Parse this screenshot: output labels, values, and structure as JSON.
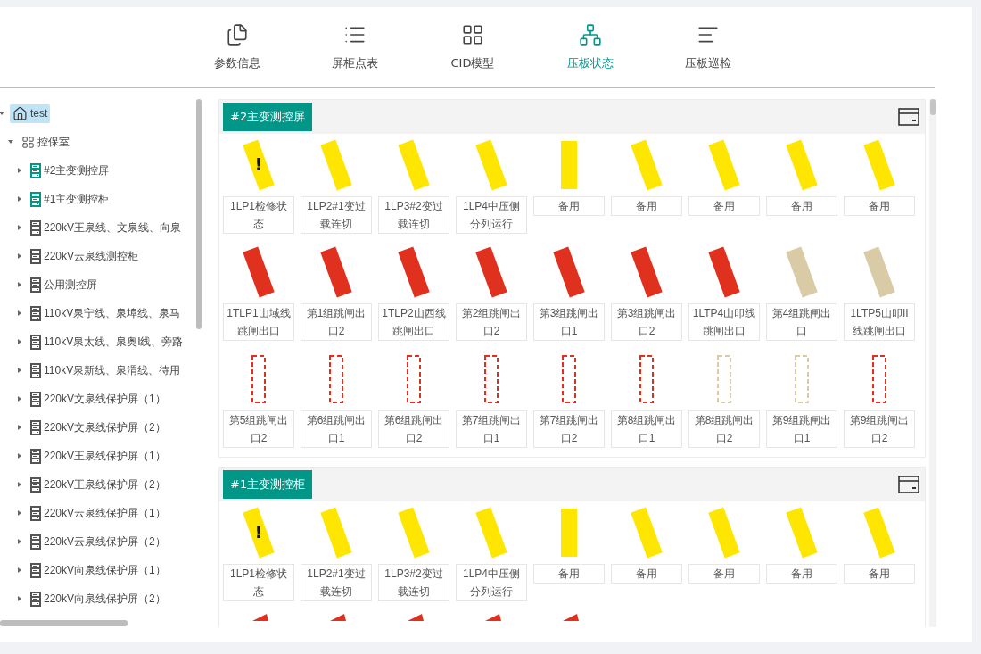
{
  "tabs": [
    {
      "label": "参数信息",
      "selected": false
    },
    {
      "label": "屏柜点表",
      "selected": false
    },
    {
      "label": "CID模型",
      "selected": false
    },
    {
      "label": "压板状态",
      "selected": true
    },
    {
      "label": "压板巡检",
      "selected": false
    }
  ],
  "tree": {
    "label": "test",
    "kind": "home",
    "expanded": true,
    "selected": true,
    "children": [
      {
        "label": "控保室",
        "kind": "room",
        "expanded": true,
        "selected": false,
        "children": [
          {
            "label": "#2主变测控屏",
            "kind": "cabinet",
            "color": "#009688",
            "expanded": false,
            "selected": false
          },
          {
            "label": "#1主变测控柜",
            "kind": "cabinet",
            "color": "#009688",
            "expanded": false,
            "selected": false
          },
          {
            "label": "220kV王泉线、文泉线、向泉",
            "kind": "cabinet",
            "color": "#555555",
            "expanded": false,
            "selected": false
          },
          {
            "label": "220kV云泉线测控柜",
            "kind": "cabinet",
            "color": "#555555",
            "expanded": false,
            "selected": false
          },
          {
            "label": "公用测控屏",
            "kind": "cabinet",
            "color": "#555555",
            "expanded": false,
            "selected": false
          },
          {
            "label": "110kV泉宁线、泉埠线、泉马",
            "kind": "cabinet",
            "color": "#555555",
            "expanded": false,
            "selected": false
          },
          {
            "label": "110kV泉太线、泉奥I线、旁路",
            "kind": "cabinet",
            "color": "#555555",
            "expanded": false,
            "selected": false
          },
          {
            "label": "110kV泉新线、泉渭线、待用",
            "kind": "cabinet",
            "color": "#555555",
            "expanded": false,
            "selected": false
          },
          {
            "label": "220kV文泉线保护屏（1）",
            "kind": "cabinet",
            "color": "#555555",
            "expanded": false,
            "selected": false
          },
          {
            "label": "220kV文泉线保护屏（2）",
            "kind": "cabinet",
            "color": "#555555",
            "expanded": false,
            "selected": false
          },
          {
            "label": "220kV王泉线保护屏（1）",
            "kind": "cabinet",
            "color": "#555555",
            "expanded": false,
            "selected": false
          },
          {
            "label": "220kV王泉线保护屏（2）",
            "kind": "cabinet",
            "color": "#555555",
            "expanded": false,
            "selected": false
          },
          {
            "label": "220kV云泉线保护屏（1）",
            "kind": "cabinet",
            "color": "#555555",
            "expanded": false,
            "selected": false
          },
          {
            "label": "220kV云泉线保护屏（2）",
            "kind": "cabinet",
            "color": "#555555",
            "expanded": false,
            "selected": false
          },
          {
            "label": "220kV向泉线保护屏（1）",
            "kind": "cabinet",
            "color": "#555555",
            "expanded": false,
            "selected": false
          },
          {
            "label": "220kV向泉线保护屏（2）",
            "kind": "cabinet",
            "color": "#555555",
            "expanded": false,
            "selected": false
          }
        ]
      }
    ]
  },
  "panels": [
    {
      "title": "#2主变测控屏",
      "plates": [
        {
          "label": "1LP1检修状态",
          "kind": "tilted",
          "color": "#ffe600",
          "badge": "!"
        },
        {
          "label": "1LP2#1变过载连切",
          "kind": "tilted",
          "color": "#ffe600"
        },
        {
          "label": "1LP3#2变过载连切",
          "kind": "tilted",
          "color": "#ffe600"
        },
        {
          "label": "1LP4中压侧分列运行",
          "kind": "tilted",
          "color": "#ffe600"
        },
        {
          "label": "备用",
          "kind": "upright",
          "color": "#ffe600"
        },
        {
          "label": "备用",
          "kind": "tilted",
          "color": "#ffe600"
        },
        {
          "label": "备用",
          "kind": "tilted",
          "color": "#ffe600"
        },
        {
          "label": "备用",
          "kind": "tilted",
          "color": "#ffe600"
        },
        {
          "label": "备用",
          "kind": "tilted",
          "color": "#ffe600"
        },
        {
          "label": "1TLP1山域线跳闸出口",
          "kind": "tilted",
          "color": "#e0301e"
        },
        {
          "label": "第1组跳闸出口2",
          "kind": "tilted",
          "color": "#e0301e"
        },
        {
          "label": "1TLP2山西线跳闸出口",
          "kind": "tilted",
          "color": "#e0301e"
        },
        {
          "label": "第2组跳闸出口2",
          "kind": "tilted",
          "color": "#e0301e"
        },
        {
          "label": "第3组跳闸出口1",
          "kind": "tilted",
          "color": "#e0301e"
        },
        {
          "label": "第3组跳闸出口2",
          "kind": "tilted",
          "color": "#e0301e"
        },
        {
          "label": "1LTP4山叩线跳闸出口",
          "kind": "tilted",
          "color": "#e0301e"
        },
        {
          "label": "第4组跳闸出口",
          "kind": "tilted",
          "color": "#d8cba6"
        },
        {
          "label": "1LTP5山叩II线跳闸出口",
          "kind": "tilted",
          "color": "#d8cba6"
        },
        {
          "label": "第5组跳闸出口2",
          "kind": "outline",
          "color": "#e0301e"
        },
        {
          "label": "第6组跳闸出口1",
          "kind": "outline",
          "color": "#e0301e"
        },
        {
          "label": "第6组跳闸出口2",
          "kind": "outline",
          "color": "#e0301e"
        },
        {
          "label": "第7组跳闸出口1",
          "kind": "outline",
          "color": "#e0301e"
        },
        {
          "label": "第7组跳闸出口2",
          "kind": "outline",
          "color": "#e0301e"
        },
        {
          "label": "第8组跳闸出口1",
          "kind": "outline",
          "color": "#e0301e"
        },
        {
          "label": "第8组跳闸出口2",
          "kind": "outline",
          "color": "#d8cba6"
        },
        {
          "label": "第9组跳闸出口1",
          "kind": "outline",
          "color": "#d8cba6"
        },
        {
          "label": "第9组跳闸出口2",
          "kind": "outline",
          "color": "#e0301e"
        }
      ]
    },
    {
      "title": "#1主变测控柜",
      "plates": [
        {
          "label": "1LP1检修状态",
          "kind": "tilted",
          "color": "#ffe600",
          "badge": "!"
        },
        {
          "label": "1LP2#1变过载连切",
          "kind": "tilted",
          "color": "#ffe600"
        },
        {
          "label": "1LP3#2变过载连切",
          "kind": "tilted",
          "color": "#ffe600"
        },
        {
          "label": "1LP4中压侧分列运行",
          "kind": "tilted",
          "color": "#ffe600"
        },
        {
          "label": "备用",
          "kind": "upright",
          "color": "#ffe600"
        },
        {
          "label": "备用",
          "kind": "tilted",
          "color": "#ffe600"
        },
        {
          "label": "备用",
          "kind": "tilted",
          "color": "#ffe600"
        },
        {
          "label": "备用",
          "kind": "tilted",
          "color": "#ffe600"
        },
        {
          "label": "备用",
          "kind": "tilted",
          "color": "#ffe600"
        },
        {
          "kind": "tip",
          "color": "#e0301e"
        },
        {
          "kind": "tip",
          "color": "#e0301e"
        },
        {
          "kind": "tip",
          "color": "#e0301e"
        },
        {
          "kind": "tip",
          "color": "#e0301e"
        },
        {
          "kind": "tip",
          "color": "#e0301e"
        }
      ]
    }
  ]
}
